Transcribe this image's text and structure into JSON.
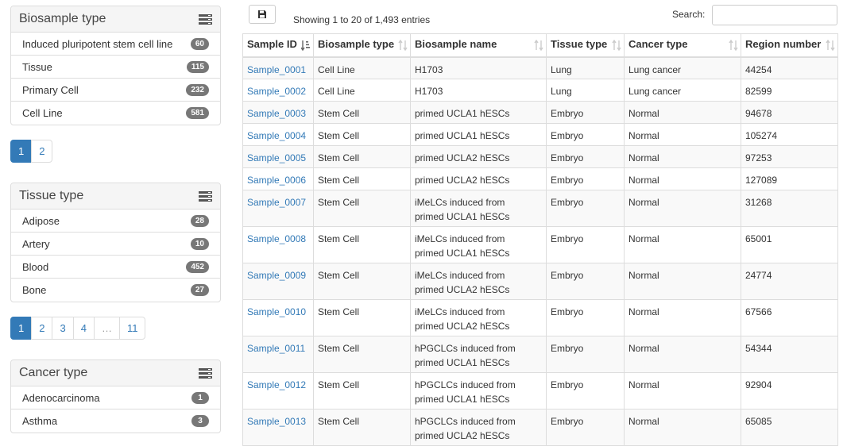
{
  "sidebar": {
    "biosample": {
      "title": "Biosample type",
      "items": [
        {
          "label": "Induced pluripotent stem cell line",
          "count": "60"
        },
        {
          "label": "Tissue",
          "count": "115"
        },
        {
          "label": "Primary Cell",
          "count": "232"
        },
        {
          "label": "Cell Line",
          "count": "581"
        }
      ],
      "pages": [
        "1",
        "2"
      ]
    },
    "tissue": {
      "title": "Tissue type",
      "items": [
        {
          "label": "Adipose",
          "count": "28"
        },
        {
          "label": "Artery",
          "count": "10"
        },
        {
          "label": "Blood",
          "count": "452"
        },
        {
          "label": "Bone",
          "count": "27"
        }
      ],
      "pages": [
        "1",
        "2",
        "3",
        "4",
        "…",
        "11"
      ]
    },
    "cancer": {
      "title": "Cancer type",
      "items": [
        {
          "label": "Adenocarcinoma",
          "count": "1"
        },
        {
          "label": "Asthma",
          "count": "3"
        }
      ]
    }
  },
  "main": {
    "info": "Showing 1 to 20 of 1,493 entries",
    "search_label": "Search:",
    "search_value": "",
    "columns": [
      "Sample ID",
      "Biosample type",
      "Biosample name",
      "Tissue type",
      "Cancer type",
      "Region number"
    ],
    "rows": [
      {
        "id": "Sample_0001",
        "type": "Cell Line",
        "name1": "H1703",
        "name2": "",
        "tissue": "Lung",
        "cancer": "Lung cancer",
        "region": "44254"
      },
      {
        "id": "Sample_0002",
        "type": "Cell Line",
        "name1": "H1703",
        "name2": "",
        "tissue": "Lung",
        "cancer": "Lung cancer",
        "region": "82599"
      },
      {
        "id": "Sample_0003",
        "type": "Stem Cell",
        "name1": "primed UCLA1 hESCs",
        "name2": "",
        "tissue": "Embryo",
        "cancer": "Normal",
        "region": "94678"
      },
      {
        "id": "Sample_0004",
        "type": "Stem Cell",
        "name1": "primed UCLA1 hESCs",
        "name2": "",
        "tissue": "Embryo",
        "cancer": "Normal",
        "region": "105274"
      },
      {
        "id": "Sample_0005",
        "type": "Stem Cell",
        "name1": "primed UCLA2 hESCs",
        "name2": "",
        "tissue": "Embryo",
        "cancer": "Normal",
        "region": "97253"
      },
      {
        "id": "Sample_0006",
        "type": "Stem Cell",
        "name1": "primed UCLA2 hESCs",
        "name2": "",
        "tissue": "Embryo",
        "cancer": "Normal",
        "region": "127089"
      },
      {
        "id": "Sample_0007",
        "type": "Stem Cell",
        "name1": "iMeLCs induced from",
        "name2": "primed UCLA1 hESCs",
        "tissue": "Embryo",
        "cancer": "Normal",
        "region": "31268"
      },
      {
        "id": "Sample_0008",
        "type": "Stem Cell",
        "name1": "iMeLCs induced from",
        "name2": "primed UCLA1 hESCs",
        "tissue": "Embryo",
        "cancer": "Normal",
        "region": "65001"
      },
      {
        "id": "Sample_0009",
        "type": "Stem Cell",
        "name1": "iMeLCs induced from",
        "name2": "primed UCLA2 hESCs",
        "tissue": "Embryo",
        "cancer": "Normal",
        "region": "24774"
      },
      {
        "id": "Sample_0010",
        "type": "Stem Cell",
        "name1": "iMeLCs induced from",
        "name2": "primed UCLA2 hESCs",
        "tissue": "Embryo",
        "cancer": "Normal",
        "region": "67566"
      },
      {
        "id": "Sample_0011",
        "type": "Stem Cell",
        "name1": "hPGCLCs induced from",
        "name2": "primed UCLA1 hESCs",
        "tissue": "Embryo",
        "cancer": "Normal",
        "region": "54344"
      },
      {
        "id": "Sample_0012",
        "type": "Stem Cell",
        "name1": "hPGCLCs induced from",
        "name2": "primed UCLA1 hESCs",
        "tissue": "Embryo",
        "cancer": "Normal",
        "region": "92904"
      },
      {
        "id": "Sample_0013",
        "type": "Stem Cell",
        "name1": "hPGCLCs induced from",
        "name2": "primed UCLA2 hESCs",
        "tissue": "Embryo",
        "cancer": "Normal",
        "region": "65085"
      }
    ]
  }
}
